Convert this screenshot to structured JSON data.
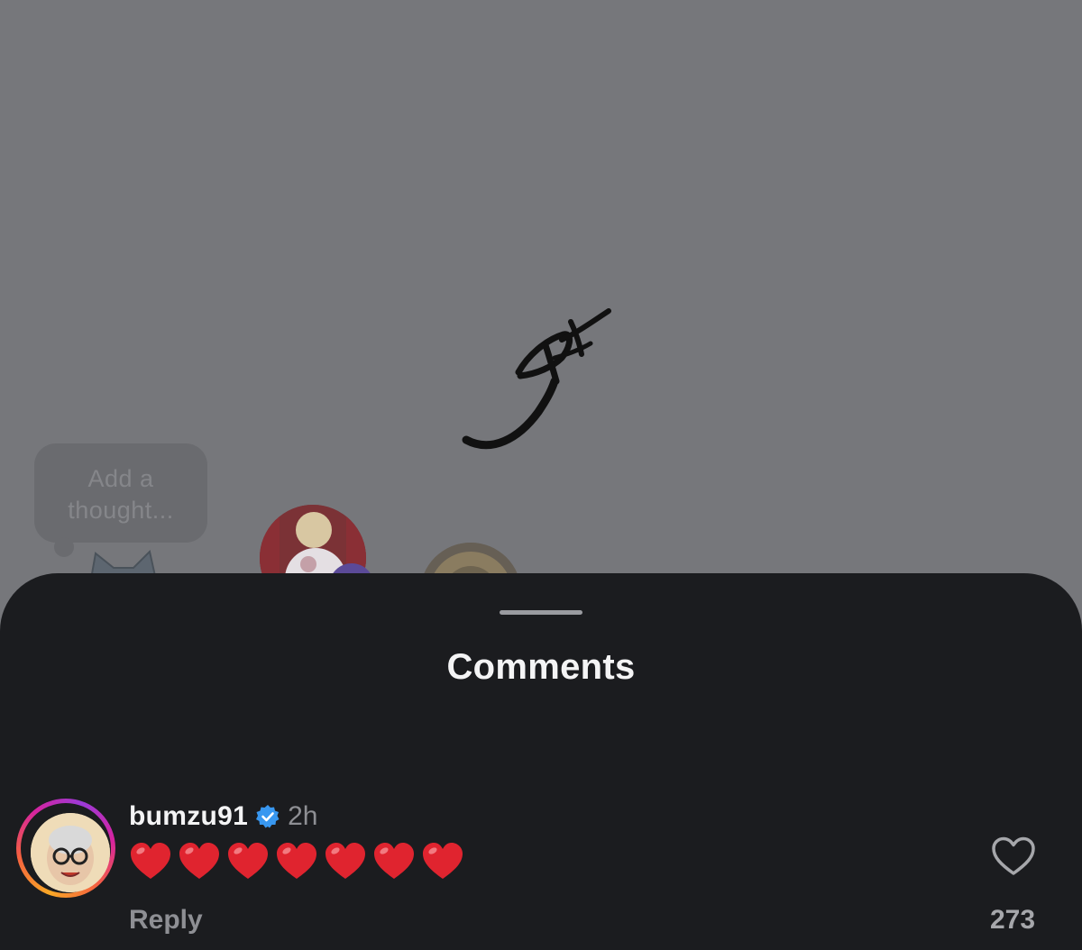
{
  "background_post": {
    "thought_placeholder_line1": "Add a",
    "thought_placeholder_line2": "thought..."
  },
  "sheet": {
    "title": "Comments"
  },
  "comment": {
    "username": "bumzu91",
    "verified_icon": "verified-badge-icon",
    "time": "2h",
    "text_emojis": [
      "red-heart",
      "red-heart",
      "red-heart",
      "red-heart",
      "red-heart",
      "red-heart",
      "red-heart"
    ],
    "reply_label": "Reply",
    "like_icon": "heart-outline-icon",
    "like_count": "273"
  },
  "colors": {
    "sheet_bg": "#1b1c1f",
    "overlay_bg": "#76777b",
    "verified_blue": "#3897f0",
    "heart_red": "#e0242f"
  }
}
